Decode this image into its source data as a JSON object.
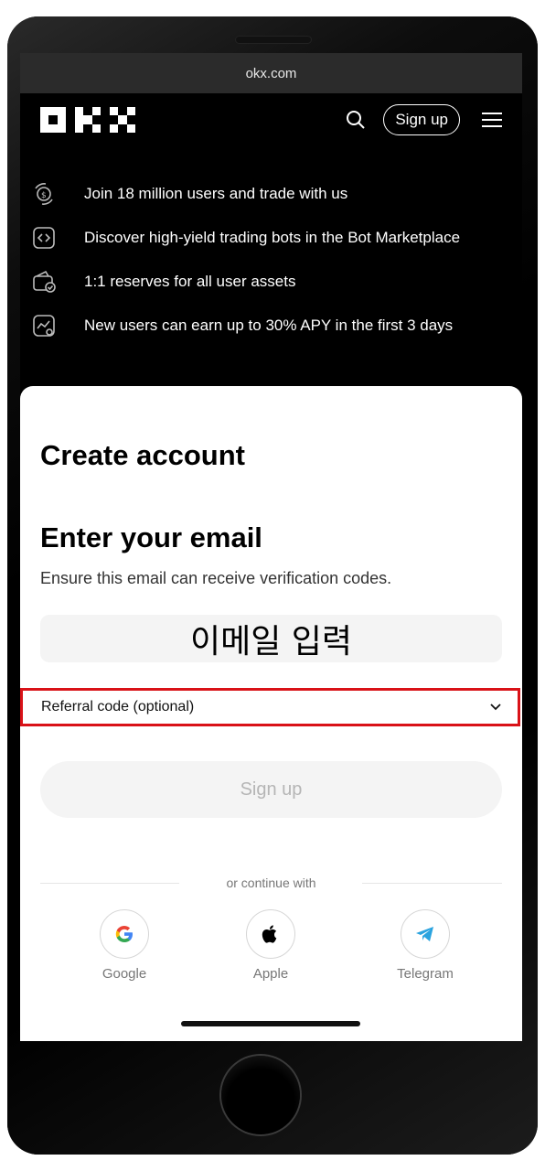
{
  "browser": {
    "url": "okx.com"
  },
  "nav": {
    "signup_label": "Sign up"
  },
  "features": [
    {
      "icon": "dollar-coin-rotate-icon",
      "text": "Join 18 million users and trade with us"
    },
    {
      "icon": "code-bracket-icon",
      "text": "Discover high-yield trading bots in the Bot Marketplace"
    },
    {
      "icon": "wallet-check-icon",
      "text": "1:1 reserves for all user assets"
    },
    {
      "icon": "chart-star-icon",
      "text": "New users can earn up to 30% APY in the first 3 days"
    }
  ],
  "form": {
    "title": "Create account",
    "heading": "Enter your email",
    "subtitle": "Ensure this email can receive verification codes.",
    "email_placeholder": "이메일 입력",
    "referral_label": "Referral code (optional)",
    "signup_button": "Sign up",
    "or_text": "or continue with"
  },
  "social": [
    {
      "label": "Google",
      "icon": "google-icon"
    },
    {
      "label": "Apple",
      "icon": "apple-icon"
    },
    {
      "label": "Telegram",
      "icon": "telegram-icon"
    }
  ],
  "colors": {
    "highlight": "#d91218",
    "telegram": "#2aa3df",
    "dark": "#000000"
  }
}
